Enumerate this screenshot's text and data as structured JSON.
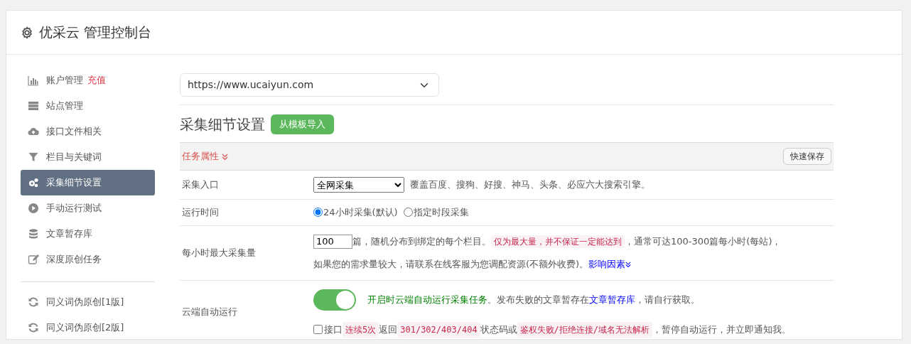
{
  "header": {
    "title": "优采云 管理控制台"
  },
  "sidebar": {
    "groups": [
      [
        {
          "label": "账户管理",
          "badge": "充值",
          "selected": false
        },
        {
          "label": "站点管理",
          "selected": false
        },
        {
          "label": "接口文件相关",
          "selected": false
        },
        {
          "label": "栏目与关键词",
          "selected": false
        },
        {
          "label": "采集细节设置",
          "selected": true
        },
        {
          "label": "手动运行测试",
          "selected": false
        },
        {
          "label": "文章暂存库",
          "selected": false
        },
        {
          "label": "深度原创任务",
          "selected": false
        }
      ],
      [
        {
          "label": "同义词伪原创[1版]",
          "selected": false
        },
        {
          "label": "同义词伪原创[2版]",
          "selected": false
        }
      ]
    ]
  },
  "site_select": {
    "value": "https://www.ucaiyun.com"
  },
  "section": {
    "title": "采集细节设置",
    "button": "从模板导入"
  },
  "panel": {
    "heading": "任务属性",
    "save_button": "快速保存",
    "rows": [
      {
        "label": "采集入口",
        "kind": "select",
        "value": "全网采集",
        "note": "覆盖百度、搜狗、好搜、神马、头条、必应六大搜索引擎。"
      },
      {
        "label": "运行时间",
        "kind": "radios",
        "options": [
          {
            "label": "24小时采集(默认)",
            "selected": true
          },
          {
            "label": "指定时段采集",
            "selected": false
          }
        ]
      },
      {
        "label": "每小时最大采集量",
        "kind": "amount",
        "value": "100",
        "lines": [
          [
            {
              "text": "篇，随机分布到绑定的每个栏目。",
              "kind": "plain"
            },
            {
              "text": "仅为最大量，并不保证一定能达到",
              "kind": "code"
            },
            {
              "text": "，通常可达100-300篇每小时(每站)，",
              "kind": "plain"
            }
          ],
          [
            {
              "text": "如果您的需求量较大，请联系在线客服为您调配资源(不额外收费)。",
              "kind": "plain"
            },
            {
              "text": "影响因素",
              "kind": "link"
            }
          ]
        ]
      },
      {
        "label": "云端自动运行",
        "kind": "toggle",
        "on": true,
        "lines": [
          [
            {
              "text": "开启时云端自动运行采集任务",
              "kind": "green"
            },
            {
              "text": "。发布失败的文章暂存在",
              "kind": "plain"
            },
            {
              "text": "文章暂存库",
              "kind": "link"
            },
            {
              "text": "，请自行获取。",
              "kind": "plain"
            }
          ]
        ],
        "check": {
          "checked": false,
          "segments": [
            {
              "text": "接口",
              "kind": "plain"
            },
            {
              "text": "连续5次",
              "kind": "code"
            },
            {
              "text": "返回",
              "kind": "plain"
            },
            {
              "text": "301/302/403/404",
              "kind": "code"
            },
            {
              "text": "状态码或",
              "kind": "plain"
            },
            {
              "text": "鉴权失败/拒绝连接/域名无法解析",
              "kind": "code"
            },
            {
              "text": "，暂停自动运行，并立即通知我。",
              "kind": "plain"
            }
          ]
        }
      }
    ]
  }
}
